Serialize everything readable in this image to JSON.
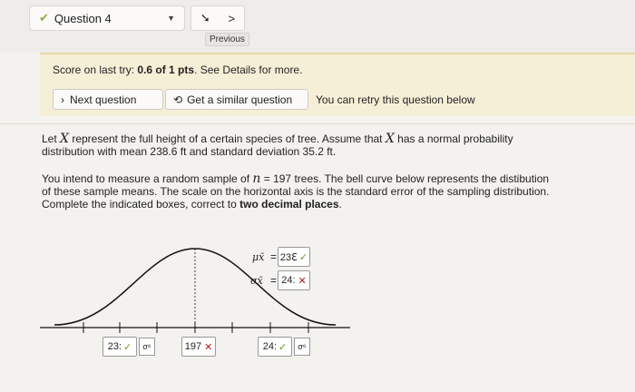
{
  "header": {
    "question_label": "Question 4",
    "prev_glyph": "➘",
    "next_glyph": ">",
    "previous_label": "Previous"
  },
  "score": {
    "prefix": "Score on last try: ",
    "value": "0.6 of 1 pts",
    "suffix": ". See Details for more."
  },
  "actions": {
    "next_question": "Next question",
    "similar_question": "Get a similar question",
    "retry_text": "You can retry this question below"
  },
  "problem": {
    "p1a": "Let ",
    "var_x": "X",
    "p1b": " represent the full height of a certain species of tree. Assume that ",
    "p1c": " has a normal probability",
    "p1d": "distribution with mean 238.6 ft and standard deviation 35.2 ft.",
    "p2a": "You intend to measure a random sample of ",
    "var_n": "n",
    "p2b": " = 197 trees. The bell curve below represents the distibution",
    "p2c": "of these sample means. The scale on the horizontal axis is the standard error of the sampling distribution.",
    "p2d": "Complete the indicated boxes, correct to ",
    "p2e": "two decimal places",
    "p2f": "."
  },
  "graph": {
    "mu_label": "μx̄",
    "mu_eq": "=",
    "mu_value": "23ℇ",
    "sigma_label": "σx̄",
    "sigma_eq": "=",
    "sigma_value": "24:",
    "box_left": "23:",
    "box_mid": "197",
    "box_right": "24:",
    "sigma_btn": "σ⁶",
    "check": "✓",
    "cross": "✕"
  }
}
